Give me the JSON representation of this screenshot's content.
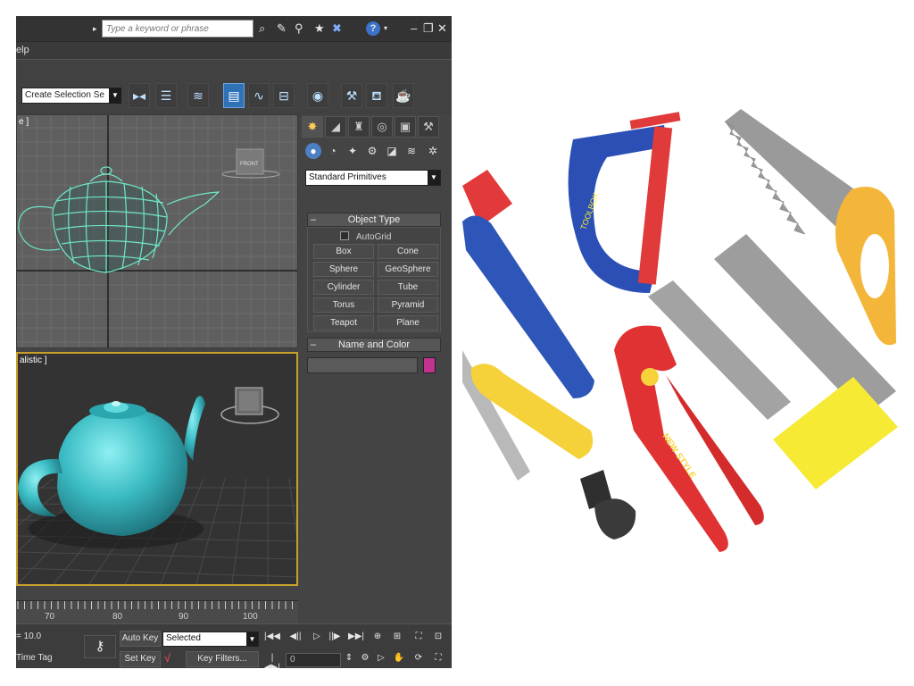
{
  "titlebar": {
    "search_placeholder": "Type a keyword or phrase",
    "icons": [
      "binoculars-icon",
      "wrench-icon",
      "satellite-icon",
      "star-icon",
      "x-icon",
      "help-icon",
      "minimize-icon",
      "restore-icon",
      "close-icon"
    ]
  },
  "menubar": {
    "help_label": "elp"
  },
  "toolbar": {
    "selection_set": "Create Selection Se",
    "tools": [
      "mirror",
      "align",
      "layer-manager",
      "scene-explorer",
      "curve-editor",
      "schematic-view",
      "material-editor",
      "render-setup",
      "rendered-frame",
      "render"
    ]
  },
  "viewports": {
    "front_label": "e ]",
    "persp_label": "alistic ]",
    "viewcube_label": "FRONT",
    "teapot_wire_color": "#6ee6c8",
    "teapot_shaded_color": "#3bbcc4",
    "active_border_color": "#c9a02a"
  },
  "command_panel": {
    "tabs": [
      "create",
      "modify",
      "hierarchy",
      "motion",
      "display",
      "utilities"
    ],
    "categories": [
      "geometry",
      "shapes",
      "lights",
      "cameras",
      "helpers",
      "space-warps",
      "systems"
    ],
    "primitive_type": "Standard Primitives",
    "object_type_title": "Object Type",
    "rollout_minus": "–",
    "autogrid_label": "AutoGrid",
    "buttons": [
      "Box",
      "Cone",
      "Sphere",
      "GeoSphere",
      "Cylinder",
      "Tube",
      "Torus",
      "Pyramid",
      "Teapot",
      "Plane"
    ],
    "name_color_title": "Name and Color",
    "object_color": "#c2338f"
  },
  "timeline": {
    "ticks": [
      "70",
      "80",
      "90",
      "100"
    ]
  },
  "status": {
    "coordinate": "= 10.0",
    "time_tag": "Time Tag",
    "auto_key": "Auto Key",
    "set_key": "Set Key",
    "selected": "Selected",
    "key_filters": "Key Filters...",
    "frame_value": "0"
  },
  "photo": {
    "brand_text_clamp": "TOOLBOX",
    "brand_text_wrench": "NEW STYLE"
  }
}
